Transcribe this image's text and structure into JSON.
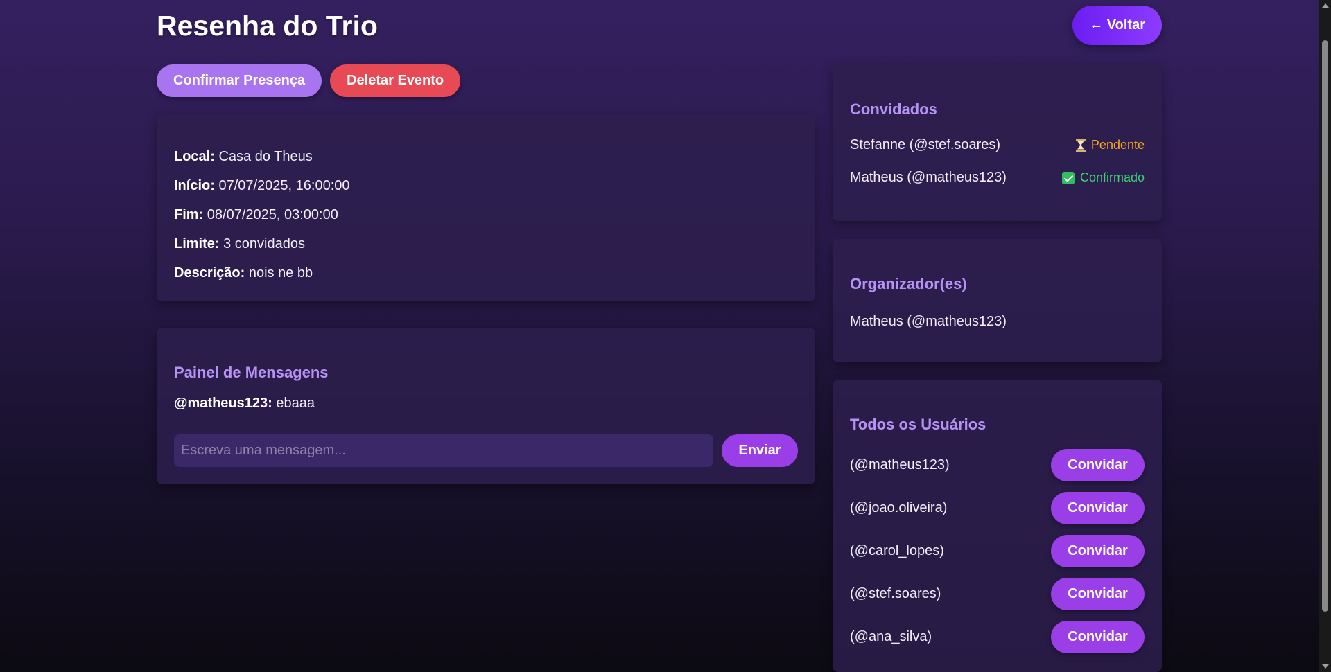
{
  "event": {
    "title": "Resenha do Trio",
    "back_label": "← Voltar",
    "confirm_label": "Confirmar Presença",
    "delete_label": "Deletar Evento"
  },
  "details": {
    "local_label": "Local:",
    "local_value": "Casa do Theus",
    "start_label": "Início:",
    "start_value": "07/07/2025, 16:00:00",
    "end_label": "Fim:",
    "end_value": "08/07/2025, 03:00:00",
    "limit_label": "Limite:",
    "limit_value": "3 convidados",
    "description_label": "Descrição:",
    "description_value": "nois ne bb"
  },
  "messages": {
    "title": "Painel de Mensagens",
    "items": [
      {
        "author": "@matheus123:",
        "text": "ebaaa"
      }
    ],
    "input_placeholder": "Escreva uma mensagem...",
    "send_label": "Enviar"
  },
  "guests": {
    "title": "Convidados",
    "items": [
      {
        "name": "Stefanne (@stef.soares)",
        "status": "Pendente",
        "status_icon": "hourglass-icon",
        "status_color": "#f6a623"
      },
      {
        "name": "Matheus (@matheus123)",
        "status": "Confirmado",
        "status_icon": "check-icon",
        "status_color": "#3fcf73"
      }
    ]
  },
  "organizers": {
    "title": "Organizador(es)",
    "items": [
      "Matheus (@matheus123)"
    ]
  },
  "users": {
    "title": "Todos os Usuários",
    "invite_label": "Convidar",
    "items": [
      "(@matheus123)",
      "(@joao.oliveira)",
      "(@carol_lopes)",
      "(@stef.soares)",
      "(@ana_silva)"
    ]
  }
}
